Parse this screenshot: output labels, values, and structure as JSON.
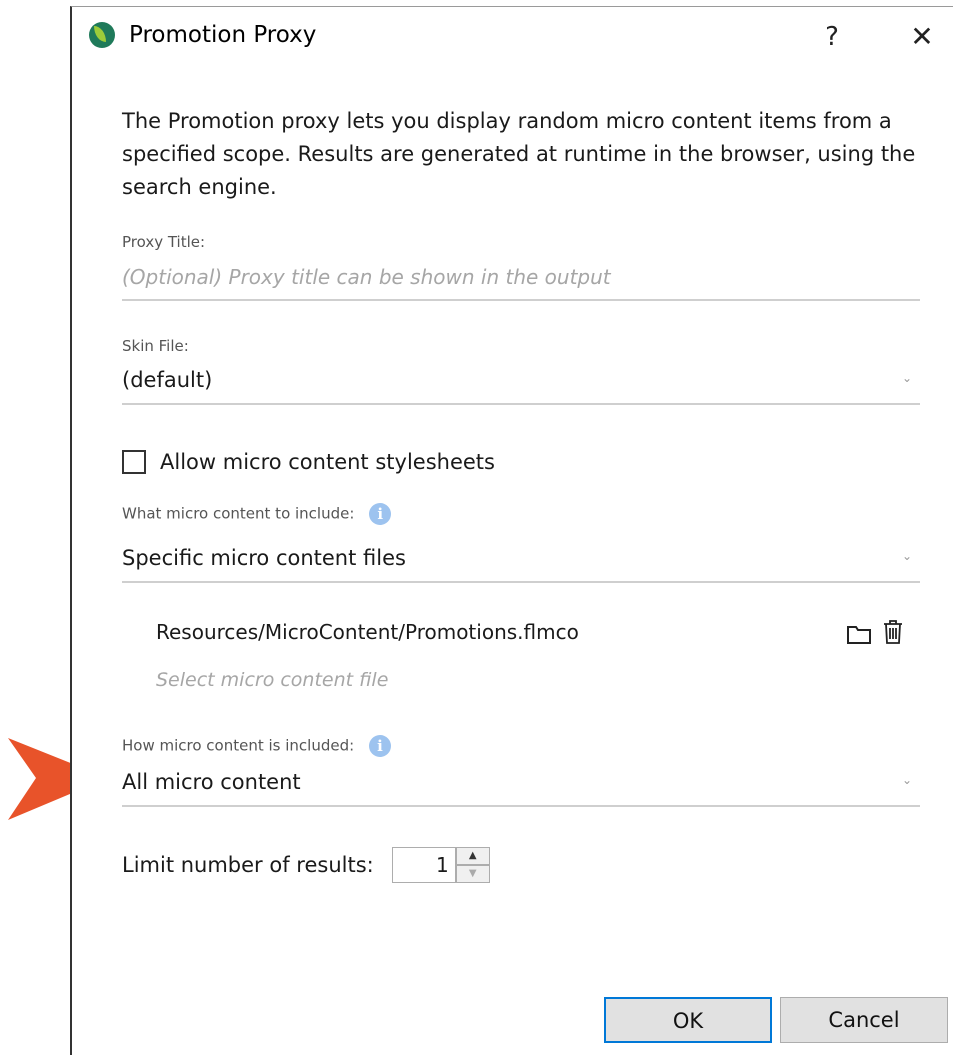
{
  "window": {
    "title": "Promotion Proxy",
    "help_label": "?",
    "close_label": "✕"
  },
  "description": "The Promotion proxy lets you display random micro content items from a specified scope. Results are generated at runtime in the browser, using the search engine.",
  "proxy_title": {
    "label": "Proxy Title:",
    "placeholder": "(Optional) Proxy title can be shown in the output"
  },
  "skin_file": {
    "label": "Skin File:",
    "value": "(default)"
  },
  "allow_stylesheets": {
    "label": "Allow micro content stylesheets",
    "checked": false
  },
  "what_to_include": {
    "label": "What micro content to include:",
    "value": "Specific micro content files"
  },
  "files": {
    "items": [
      "Resources/MicroContent/Promotions.flmco"
    ],
    "select_placeholder": "Select micro content file"
  },
  "how_included": {
    "label": "How micro content is included:",
    "value": "All micro content"
  },
  "limit": {
    "label": "Limit number of results:",
    "value": "1"
  },
  "buttons": {
    "ok": "OK",
    "cancel": "Cancel"
  },
  "colors": {
    "accent": "#0078d7",
    "info": "#9dc3ef",
    "arrow": "#e8532a"
  },
  "icons": {
    "info": "i",
    "chevron": "⌄",
    "spin_up": "▲",
    "spin_down": "▼"
  }
}
